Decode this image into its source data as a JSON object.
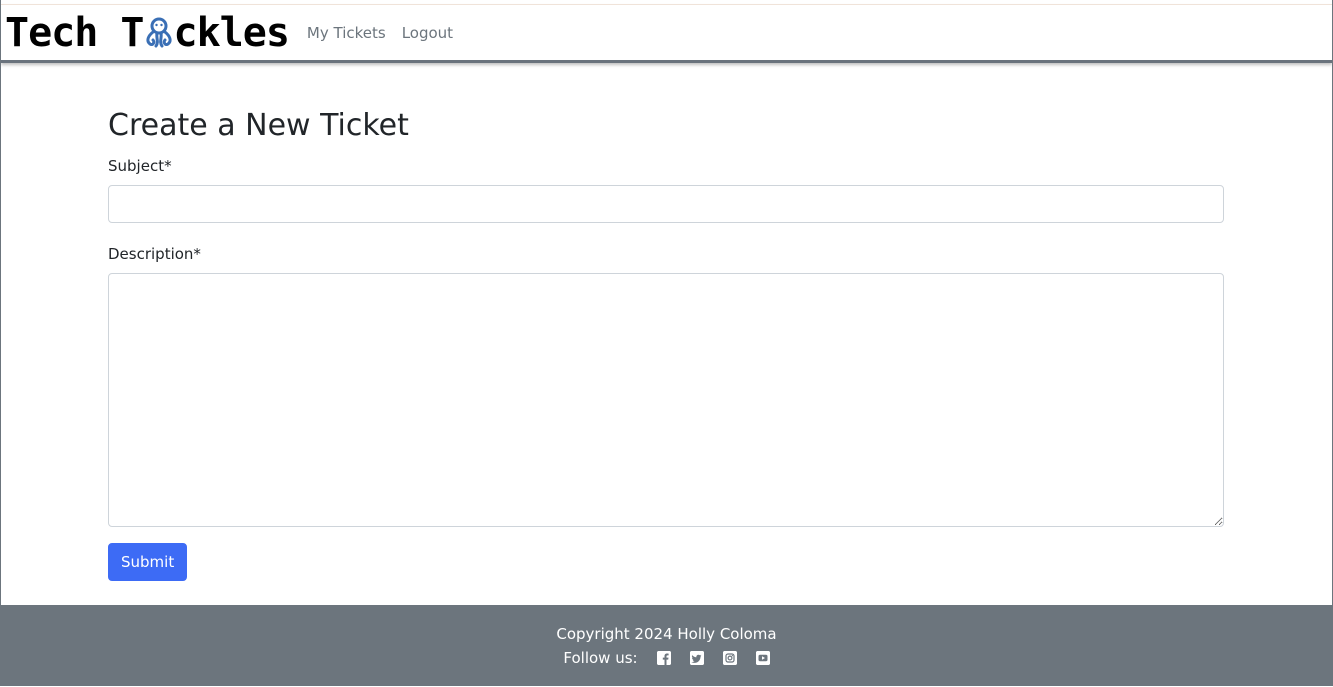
{
  "brand": {
    "name_prefix": "Tech T",
    "name_suffix": "ckles",
    "logo_icon": "octopus-icon",
    "accent_color": "#3a6fb5"
  },
  "nav": {
    "links": [
      {
        "label": "My Tickets"
      },
      {
        "label": "Logout"
      }
    ]
  },
  "form": {
    "title": "Create a New Ticket",
    "subject_label": "Subject*",
    "subject_value": "",
    "description_label": "Description*",
    "description_value": "",
    "submit_label": "Submit",
    "submit_color": "#3d6bf5"
  },
  "footer": {
    "copyright": "Copyright 2024 Holly Coloma",
    "follow_label": "Follow us:",
    "social_icons": [
      "facebook-icon",
      "twitter-icon",
      "instagram-icon",
      "youtube-icon"
    ],
    "background_color": "#6c757d"
  }
}
